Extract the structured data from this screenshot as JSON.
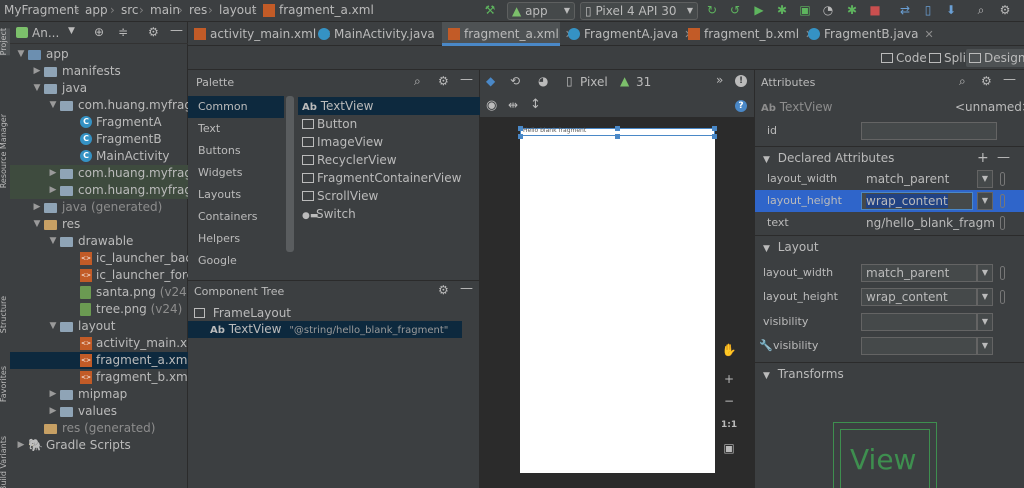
{
  "breadcrumbs": [
    "MyFragment",
    "app",
    "src",
    "main",
    "res",
    "layout",
    "fragment_a.xml"
  ],
  "run_config": "app",
  "device": "Pixel 4 API 30",
  "project_panel": {
    "title": "An..."
  },
  "project_tree": [
    {
      "label": "app",
      "kind": "module"
    },
    {
      "label": "manifests",
      "kind": "folder"
    },
    {
      "label": "java",
      "kind": "folder"
    },
    {
      "label": "com.huang.myfragme",
      "kind": "package"
    },
    {
      "label": "FragmentA",
      "kind": "class"
    },
    {
      "label": "FragmentB",
      "kind": "class"
    },
    {
      "label": "MainActivity",
      "kind": "class"
    },
    {
      "label": "com.huang.myfragme",
      "kind": "package"
    },
    {
      "label": "com.huang.myfragme",
      "kind": "package"
    },
    {
      "label": "java (generated)",
      "kind": "folder"
    },
    {
      "label": "res",
      "kind": "folder"
    },
    {
      "label": "drawable",
      "kind": "folder"
    },
    {
      "label": "ic_launcher_backg",
      "kind": "xml"
    },
    {
      "label": "ic_launcher_foregr",
      "kind": "xml"
    },
    {
      "label": "santa.png",
      "suffix": "(v24)",
      "kind": "png"
    },
    {
      "label": "tree.png",
      "suffix": "(v24)",
      "kind": "png"
    },
    {
      "label": "layout",
      "kind": "folder"
    },
    {
      "label": "activity_main.xml",
      "kind": "xml"
    },
    {
      "label": "fragment_a.xml",
      "kind": "xml"
    },
    {
      "label": "fragment_b.xml",
      "kind": "xml"
    },
    {
      "label": "mipmap",
      "kind": "folder"
    },
    {
      "label": "values",
      "kind": "folder"
    },
    {
      "label": "res (generated)",
      "kind": "folder"
    },
    {
      "label": "Gradle Scripts",
      "kind": "gradle"
    }
  ],
  "left_strip": [
    "Project",
    "Resource Manager",
    "Structure",
    "Favorites",
    "Build Variants"
  ],
  "tabs": [
    {
      "label": "activity_main.xml",
      "kind": "xml"
    },
    {
      "label": "MainActivity.java",
      "kind": "class"
    },
    {
      "label": "fragment_a.xml",
      "kind": "xml"
    },
    {
      "label": "FragmentA.java",
      "kind": "class"
    },
    {
      "label": "fragment_b.xml",
      "kind": "xml"
    },
    {
      "label": "FragmentB.java",
      "kind": "class"
    }
  ],
  "view_modes": {
    "code": "Code",
    "split": "Split",
    "design": "Design"
  },
  "palette": {
    "title": "Palette",
    "categories": [
      "Common",
      "Text",
      "Buttons",
      "Widgets",
      "Layouts",
      "Containers",
      "Helpers",
      "Google"
    ],
    "widgets": [
      "TextView",
      "Button",
      "ImageView",
      "RecyclerView",
      "FragmentContainerView",
      "ScrollView",
      "Switch"
    ],
    "textview_prefix": "Ab"
  },
  "component_tree": {
    "title": "Component Tree",
    "root": "FrameLayout",
    "child_prefix": "Ab",
    "child": "TextView",
    "child_text": "\"@string/hello_blank_fragment\""
  },
  "canvas": {
    "device_label": "Pixel",
    "api_level": "31",
    "preview_text": "Hello blank fragment",
    "zoom_fit": "1:1"
  },
  "attributes": {
    "title": "Attributes",
    "prefix": "Ab",
    "widget": "TextView",
    "unnamed": "<unnamed>",
    "id_label": "id",
    "id_value": "",
    "declared_title": "Declared Attributes",
    "declared": [
      {
        "name": "layout_width",
        "value": "match_parent"
      },
      {
        "name": "layout_height",
        "value": "wrap_content"
      },
      {
        "name": "text",
        "value": "ng/hello_blank_fragment"
      }
    ],
    "layout_title": "Layout",
    "layout": [
      {
        "name": "layout_width",
        "value": "match_parent"
      },
      {
        "name": "layout_height",
        "value": "wrap_content"
      },
      {
        "name": "visibility",
        "value": ""
      },
      {
        "name": "visibility",
        "value": ""
      }
    ],
    "transforms_title": "Transforms",
    "preview_label": "View"
  }
}
